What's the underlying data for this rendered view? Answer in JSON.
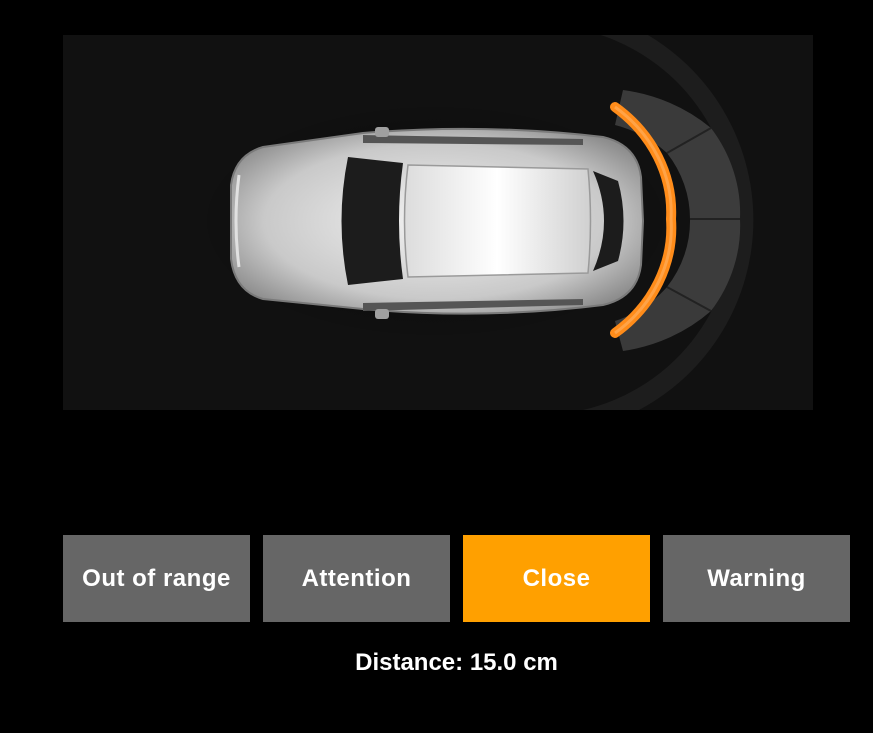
{
  "zones": [
    {
      "label": "Out of range",
      "active": false
    },
    {
      "label": "Attention",
      "active": false
    },
    {
      "label": "Close",
      "active": true
    },
    {
      "label": "Warning",
      "active": false
    }
  ],
  "active_zone": "Close",
  "distance_text": "Distance: 15.0 cm",
  "distance_cm": 15.0,
  "colors": {
    "active": "#ffa000",
    "inactive": "#666666",
    "sensor_lit": "#ff8c1a",
    "sensor_idle": "#3a3a3a",
    "background": "#000000"
  },
  "icons": {
    "car": "car-top-view-icon",
    "sensor": "parking-sensor-arc-icon"
  }
}
